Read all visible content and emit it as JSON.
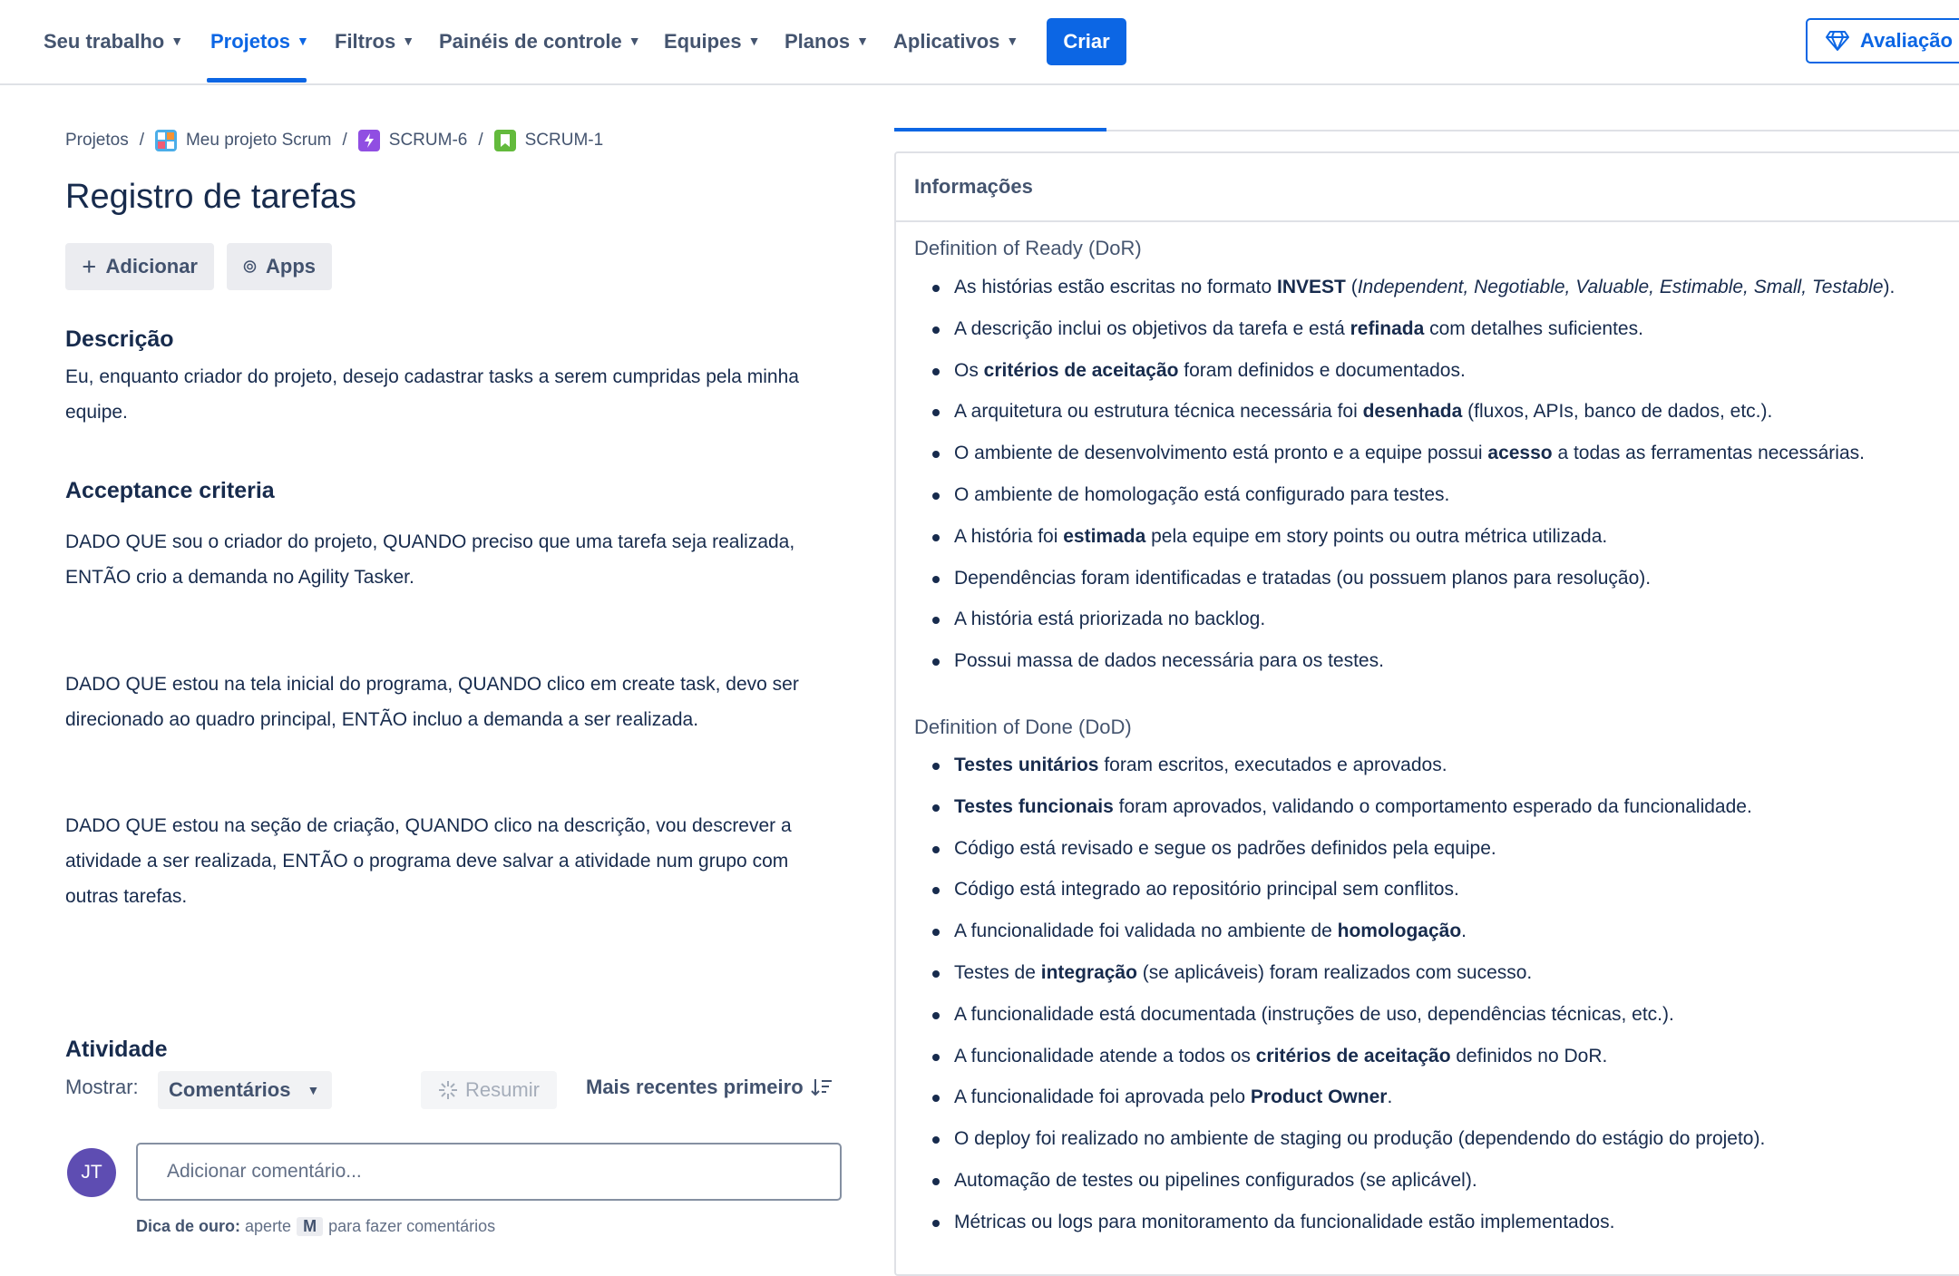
{
  "nav": {
    "items": [
      {
        "label": "Seu trabalho",
        "active": false
      },
      {
        "label": "Projetos",
        "active": true
      },
      {
        "label": "Filtros",
        "active": false
      },
      {
        "label": "Painéis de controle",
        "active": false
      },
      {
        "label": "Equipes",
        "active": false
      },
      {
        "label": "Planos",
        "active": false
      },
      {
        "label": "Aplicativos",
        "active": false
      }
    ],
    "create_label": "Criar",
    "trial_label": "Avaliação"
  },
  "breadcrumb": {
    "root": "Projetos",
    "project": "Meu projeto Scrum",
    "epic": "SCRUM-6",
    "story": "SCRUM-1",
    "separator": "/"
  },
  "issue": {
    "title": "Registro de tarefas",
    "add_label": "Adicionar",
    "apps_label": "Apps",
    "description_heading": "Descrição",
    "description": "Eu, enquanto criador do projeto, desejo cadastrar tasks a serem cumpridas pela minha equipe.",
    "acceptance_heading": "Acceptance criteria",
    "criteria": [
      "DADO QUE sou o criador do projeto, QUANDO preciso que uma tarefa seja realizada, ENTÃO crio a demanda no Agility Tasker.",
      "DADO QUE estou na tela inicial do programa, QUANDO clico em create task, devo ser direcionado ao quadro principal, ENTÃO incluo a demanda a ser realizada.",
      "DADO QUE estou na seção de criação, QUANDO clico na descrição, vou descrever a atividade a ser realizada, ENTÃO o programa deve salvar a atividade num grupo com outras tarefas."
    ]
  },
  "activity": {
    "heading": "Atividade",
    "show_label": "Mostrar:",
    "show_value": "Comentários",
    "summarize_label": "Resumir",
    "sort_label": "Mais recentes primeiro",
    "avatar_initials": "JT",
    "comment_placeholder": "Adicionar comentário...",
    "tip_bold": "Dica de ouro:",
    "tip_pre": "aperte",
    "tip_key": "M",
    "tip_post": "para fazer comentários"
  },
  "info_panel": {
    "header": "Informações",
    "dor_title": "Definition of Ready (DoR)",
    "dor_items": [
      "As histórias estão escritas no formato <b>INVEST</b> (<i>Independent, Negotiable, Valuable, Estimable, Small, Testable</i>).",
      "A descrição inclui os objetivos da tarefa e está <b>refinada</b> com detalhes suficientes.",
      "Os <b>critérios de aceitação</b> foram definidos e documentados.",
      "A arquitetura ou estrutura técnica necessária foi <b>desenhada</b> (fluxos, APIs, banco de dados, etc.).",
      "O ambiente de desenvolvimento está pronto e a equipe possui <b>acesso</b> a todas as ferramentas necessárias.",
      "O ambiente de homologação está configurado para testes.",
      "A história foi <b>estimada</b> pela equipe em story points ou outra métrica utilizada.",
      "Dependências foram identificadas e tratadas (ou possuem planos para resolução).",
      "A história está priorizada no backlog.",
      "Possui massa de dados necessária para os testes."
    ],
    "dod_title": "Definition of Done (DoD)",
    "dod_items": [
      "<b>Testes unitários</b> foram escritos, executados e aprovados.",
      "<b>Testes funcionais</b> foram aprovados, validando o comportamento esperado da funcionalidade.",
      "Código está revisado e segue os padrões definidos pela equipe.",
      "Código está integrado ao repositório principal sem conflitos.",
      "A funcionalidade foi validada no ambiente de <b>homologação</b>.",
      "Testes de <b>integração</b> (se aplicáveis) foram realizados com sucesso.",
      "A funcionalidade está documentada (instruções de uso, dependências técnicas, etc.).",
      "A funcionalidade atende a todos os <b>critérios de aceitação</b> definidos no DoR.",
      "A funcionalidade foi aprovada pelo <b>Product Owner</b>.",
      "O deploy foi realizado no ambiente de staging ou produção (dependendo do estágio do projeto).",
      "Automação de testes ou pipelines configurados (se aplicável).",
      "Métricas ou logs para monitoramento da funcionalidade estão implementados."
    ]
  },
  "colors": {
    "accent": "#0c66e4",
    "avatar": "#5e4db2",
    "text": "#172b4d",
    "subtle": "#44546f"
  },
  "icons": {
    "nav_chevron": "chevron-down-icon",
    "add": "plus-icon",
    "apps": "apps-icon",
    "trial": "gem-icon",
    "summarize": "sparkle-icon",
    "sort": "sort-icon"
  }
}
